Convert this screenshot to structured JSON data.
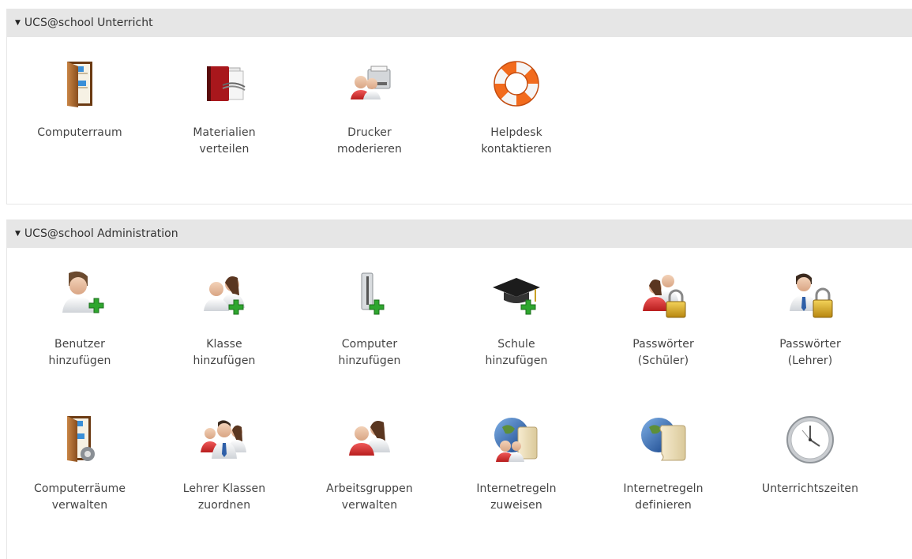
{
  "sections": [
    {
      "title": "UCS@school Unterricht",
      "tiles": [
        {
          "label": "Computerraum",
          "icon": "computer-room-icon"
        },
        {
          "label": "Materialien\nverteilen",
          "icon": "distribute-materials-icon"
        },
        {
          "label": "Drucker\nmoderieren",
          "icon": "printer-moderation-icon"
        },
        {
          "label": "Helpdesk\nkontaktieren",
          "icon": "lifebuoy-icon"
        }
      ]
    },
    {
      "title": "UCS@school Administration",
      "tiles": [
        {
          "label": "Benutzer\nhinzufügen",
          "icon": "add-user-icon"
        },
        {
          "label": "Klasse\nhinzufügen",
          "icon": "add-class-icon"
        },
        {
          "label": "Computer\nhinzufügen",
          "icon": "add-computer-icon"
        },
        {
          "label": "Schule\nhinzufügen",
          "icon": "add-school-icon"
        },
        {
          "label": "Passwörter\n(Schüler)",
          "icon": "student-passwords-icon"
        },
        {
          "label": "Passwörter\n(Lehrer)",
          "icon": "teacher-passwords-icon"
        },
        {
          "label": "Computerräume\nverwalten",
          "icon": "manage-computer-rooms-icon"
        },
        {
          "label": "Lehrer Klassen\nzuordnen",
          "icon": "assign-teachers-icon"
        },
        {
          "label": "Arbeitsgruppen\nverwalten",
          "icon": "manage-workgroups-icon"
        },
        {
          "label": "Internetregeln\nzuweisen",
          "icon": "assign-internet-rules-icon"
        },
        {
          "label": "Internetregeln\ndefinieren",
          "icon": "define-internet-rules-icon"
        },
        {
          "label": "Unterrichtszeiten",
          "icon": "clock-icon"
        }
      ]
    }
  ]
}
